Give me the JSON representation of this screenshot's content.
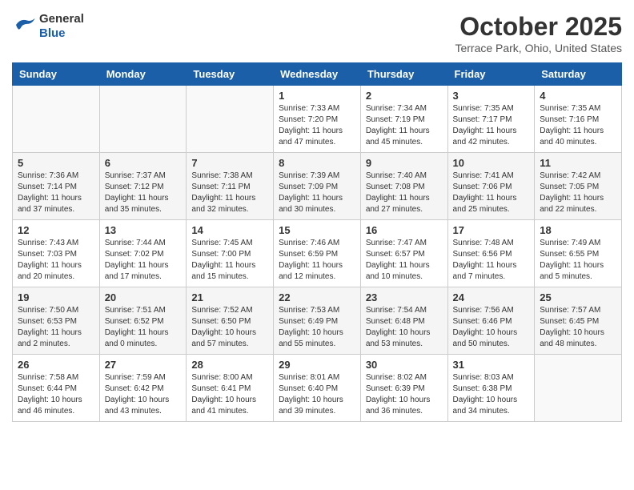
{
  "header": {
    "logo_line1": "General",
    "logo_line2": "Blue",
    "month": "October 2025",
    "location": "Terrace Park, Ohio, United States"
  },
  "weekdays": [
    "Sunday",
    "Monday",
    "Tuesday",
    "Wednesday",
    "Thursday",
    "Friday",
    "Saturday"
  ],
  "weeks": [
    [
      {
        "day": "",
        "info": ""
      },
      {
        "day": "",
        "info": ""
      },
      {
        "day": "",
        "info": ""
      },
      {
        "day": "1",
        "info": "Sunrise: 7:33 AM\nSunset: 7:20 PM\nDaylight: 11 hours and 47 minutes."
      },
      {
        "day": "2",
        "info": "Sunrise: 7:34 AM\nSunset: 7:19 PM\nDaylight: 11 hours and 45 minutes."
      },
      {
        "day": "3",
        "info": "Sunrise: 7:35 AM\nSunset: 7:17 PM\nDaylight: 11 hours and 42 minutes."
      },
      {
        "day": "4",
        "info": "Sunrise: 7:35 AM\nSunset: 7:16 PM\nDaylight: 11 hours and 40 minutes."
      }
    ],
    [
      {
        "day": "5",
        "info": "Sunrise: 7:36 AM\nSunset: 7:14 PM\nDaylight: 11 hours and 37 minutes."
      },
      {
        "day": "6",
        "info": "Sunrise: 7:37 AM\nSunset: 7:12 PM\nDaylight: 11 hours and 35 minutes."
      },
      {
        "day": "7",
        "info": "Sunrise: 7:38 AM\nSunset: 7:11 PM\nDaylight: 11 hours and 32 minutes."
      },
      {
        "day": "8",
        "info": "Sunrise: 7:39 AM\nSunset: 7:09 PM\nDaylight: 11 hours and 30 minutes."
      },
      {
        "day": "9",
        "info": "Sunrise: 7:40 AM\nSunset: 7:08 PM\nDaylight: 11 hours and 27 minutes."
      },
      {
        "day": "10",
        "info": "Sunrise: 7:41 AM\nSunset: 7:06 PM\nDaylight: 11 hours and 25 minutes."
      },
      {
        "day": "11",
        "info": "Sunrise: 7:42 AM\nSunset: 7:05 PM\nDaylight: 11 hours and 22 minutes."
      }
    ],
    [
      {
        "day": "12",
        "info": "Sunrise: 7:43 AM\nSunset: 7:03 PM\nDaylight: 11 hours and 20 minutes."
      },
      {
        "day": "13",
        "info": "Sunrise: 7:44 AM\nSunset: 7:02 PM\nDaylight: 11 hours and 17 minutes."
      },
      {
        "day": "14",
        "info": "Sunrise: 7:45 AM\nSunset: 7:00 PM\nDaylight: 11 hours and 15 minutes."
      },
      {
        "day": "15",
        "info": "Sunrise: 7:46 AM\nSunset: 6:59 PM\nDaylight: 11 hours and 12 minutes."
      },
      {
        "day": "16",
        "info": "Sunrise: 7:47 AM\nSunset: 6:57 PM\nDaylight: 11 hours and 10 minutes."
      },
      {
        "day": "17",
        "info": "Sunrise: 7:48 AM\nSunset: 6:56 PM\nDaylight: 11 hours and 7 minutes."
      },
      {
        "day": "18",
        "info": "Sunrise: 7:49 AM\nSunset: 6:55 PM\nDaylight: 11 hours and 5 minutes."
      }
    ],
    [
      {
        "day": "19",
        "info": "Sunrise: 7:50 AM\nSunset: 6:53 PM\nDaylight: 11 hours and 2 minutes."
      },
      {
        "day": "20",
        "info": "Sunrise: 7:51 AM\nSunset: 6:52 PM\nDaylight: 11 hours and 0 minutes."
      },
      {
        "day": "21",
        "info": "Sunrise: 7:52 AM\nSunset: 6:50 PM\nDaylight: 10 hours and 57 minutes."
      },
      {
        "day": "22",
        "info": "Sunrise: 7:53 AM\nSunset: 6:49 PM\nDaylight: 10 hours and 55 minutes."
      },
      {
        "day": "23",
        "info": "Sunrise: 7:54 AM\nSunset: 6:48 PM\nDaylight: 10 hours and 53 minutes."
      },
      {
        "day": "24",
        "info": "Sunrise: 7:56 AM\nSunset: 6:46 PM\nDaylight: 10 hours and 50 minutes."
      },
      {
        "day": "25",
        "info": "Sunrise: 7:57 AM\nSunset: 6:45 PM\nDaylight: 10 hours and 48 minutes."
      }
    ],
    [
      {
        "day": "26",
        "info": "Sunrise: 7:58 AM\nSunset: 6:44 PM\nDaylight: 10 hours and 46 minutes."
      },
      {
        "day": "27",
        "info": "Sunrise: 7:59 AM\nSunset: 6:42 PM\nDaylight: 10 hours and 43 minutes."
      },
      {
        "day": "28",
        "info": "Sunrise: 8:00 AM\nSunset: 6:41 PM\nDaylight: 10 hours and 41 minutes."
      },
      {
        "day": "29",
        "info": "Sunrise: 8:01 AM\nSunset: 6:40 PM\nDaylight: 10 hours and 39 minutes."
      },
      {
        "day": "30",
        "info": "Sunrise: 8:02 AM\nSunset: 6:39 PM\nDaylight: 10 hours and 36 minutes."
      },
      {
        "day": "31",
        "info": "Sunrise: 8:03 AM\nSunset: 6:38 PM\nDaylight: 10 hours and 34 minutes."
      },
      {
        "day": "",
        "info": ""
      }
    ]
  ]
}
